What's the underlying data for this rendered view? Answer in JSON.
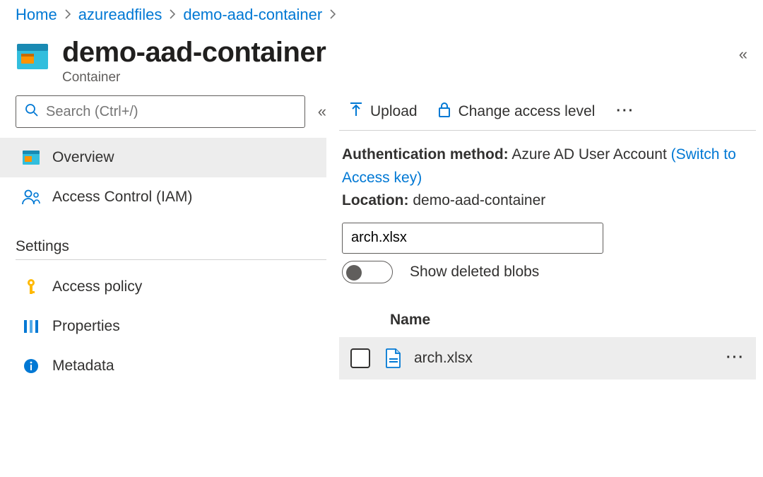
{
  "breadcrumb": {
    "items": [
      {
        "label": "Home"
      },
      {
        "label": "azureadfiles"
      },
      {
        "label": "demo-aad-container"
      }
    ]
  },
  "header": {
    "title": "demo-aad-container",
    "subtitle": "Container"
  },
  "search": {
    "placeholder": "Search (Ctrl+/)"
  },
  "sidebar": {
    "items": [
      {
        "label": "Overview",
        "icon": "container",
        "selected": true
      },
      {
        "label": "Access Control (IAM)",
        "icon": "people",
        "selected": false
      }
    ]
  },
  "settings": {
    "label": "Settings",
    "items": [
      {
        "label": "Access policy",
        "icon": "key"
      },
      {
        "label": "Properties",
        "icon": "properties"
      },
      {
        "label": "Metadata",
        "icon": "info"
      }
    ]
  },
  "toolbar": {
    "upload": "Upload",
    "change_access": "Change access level"
  },
  "info": {
    "auth_method_label": "Authentication method:",
    "auth_method_value": "Azure AD User Account",
    "switch_link": "(Switch to Access key)",
    "location_label": "Location:",
    "location_value": "demo-aad-container"
  },
  "filter": {
    "value": "arch.xlsx"
  },
  "toggle": {
    "label": "Show deleted blobs",
    "on": false
  },
  "table": {
    "columns": [
      {
        "label": "Name"
      }
    ],
    "rows": [
      {
        "name": "arch.xlsx"
      }
    ]
  }
}
